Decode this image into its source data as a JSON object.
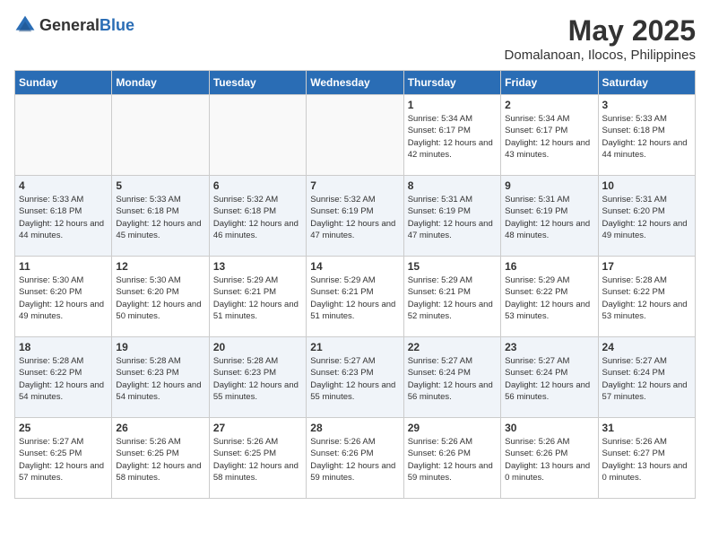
{
  "logo": {
    "general": "General",
    "blue": "Blue"
  },
  "title": {
    "month_year": "May 2025",
    "location": "Domalanoan, Ilocos, Philippines"
  },
  "weekdays": [
    "Sunday",
    "Monday",
    "Tuesday",
    "Wednesday",
    "Thursday",
    "Friday",
    "Saturday"
  ],
  "weeks": [
    [
      {
        "day": "",
        "info": ""
      },
      {
        "day": "",
        "info": ""
      },
      {
        "day": "",
        "info": ""
      },
      {
        "day": "",
        "info": ""
      },
      {
        "day": "1",
        "info": "Sunrise: 5:34 AM\nSunset: 6:17 PM\nDaylight: 12 hours\nand 42 minutes."
      },
      {
        "day": "2",
        "info": "Sunrise: 5:34 AM\nSunset: 6:17 PM\nDaylight: 12 hours\nand 43 minutes."
      },
      {
        "day": "3",
        "info": "Sunrise: 5:33 AM\nSunset: 6:18 PM\nDaylight: 12 hours\nand 44 minutes."
      }
    ],
    [
      {
        "day": "4",
        "info": "Sunrise: 5:33 AM\nSunset: 6:18 PM\nDaylight: 12 hours\nand 44 minutes."
      },
      {
        "day": "5",
        "info": "Sunrise: 5:33 AM\nSunset: 6:18 PM\nDaylight: 12 hours\nand 45 minutes."
      },
      {
        "day": "6",
        "info": "Sunrise: 5:32 AM\nSunset: 6:18 PM\nDaylight: 12 hours\nand 46 minutes."
      },
      {
        "day": "7",
        "info": "Sunrise: 5:32 AM\nSunset: 6:19 PM\nDaylight: 12 hours\nand 47 minutes."
      },
      {
        "day": "8",
        "info": "Sunrise: 5:31 AM\nSunset: 6:19 PM\nDaylight: 12 hours\nand 47 minutes."
      },
      {
        "day": "9",
        "info": "Sunrise: 5:31 AM\nSunset: 6:19 PM\nDaylight: 12 hours\nand 48 minutes."
      },
      {
        "day": "10",
        "info": "Sunrise: 5:31 AM\nSunset: 6:20 PM\nDaylight: 12 hours\nand 49 minutes."
      }
    ],
    [
      {
        "day": "11",
        "info": "Sunrise: 5:30 AM\nSunset: 6:20 PM\nDaylight: 12 hours\nand 49 minutes."
      },
      {
        "day": "12",
        "info": "Sunrise: 5:30 AM\nSunset: 6:20 PM\nDaylight: 12 hours\nand 50 minutes."
      },
      {
        "day": "13",
        "info": "Sunrise: 5:29 AM\nSunset: 6:21 PM\nDaylight: 12 hours\nand 51 minutes."
      },
      {
        "day": "14",
        "info": "Sunrise: 5:29 AM\nSunset: 6:21 PM\nDaylight: 12 hours\nand 51 minutes."
      },
      {
        "day": "15",
        "info": "Sunrise: 5:29 AM\nSunset: 6:21 PM\nDaylight: 12 hours\nand 52 minutes."
      },
      {
        "day": "16",
        "info": "Sunrise: 5:29 AM\nSunset: 6:22 PM\nDaylight: 12 hours\nand 53 minutes."
      },
      {
        "day": "17",
        "info": "Sunrise: 5:28 AM\nSunset: 6:22 PM\nDaylight: 12 hours\nand 53 minutes."
      }
    ],
    [
      {
        "day": "18",
        "info": "Sunrise: 5:28 AM\nSunset: 6:22 PM\nDaylight: 12 hours\nand 54 minutes."
      },
      {
        "day": "19",
        "info": "Sunrise: 5:28 AM\nSunset: 6:23 PM\nDaylight: 12 hours\nand 54 minutes."
      },
      {
        "day": "20",
        "info": "Sunrise: 5:28 AM\nSunset: 6:23 PM\nDaylight: 12 hours\nand 55 minutes."
      },
      {
        "day": "21",
        "info": "Sunrise: 5:27 AM\nSunset: 6:23 PM\nDaylight: 12 hours\nand 55 minutes."
      },
      {
        "day": "22",
        "info": "Sunrise: 5:27 AM\nSunset: 6:24 PM\nDaylight: 12 hours\nand 56 minutes."
      },
      {
        "day": "23",
        "info": "Sunrise: 5:27 AM\nSunset: 6:24 PM\nDaylight: 12 hours\nand 56 minutes."
      },
      {
        "day": "24",
        "info": "Sunrise: 5:27 AM\nSunset: 6:24 PM\nDaylight: 12 hours\nand 57 minutes."
      }
    ],
    [
      {
        "day": "25",
        "info": "Sunrise: 5:27 AM\nSunset: 6:25 PM\nDaylight: 12 hours\nand 57 minutes."
      },
      {
        "day": "26",
        "info": "Sunrise: 5:26 AM\nSunset: 6:25 PM\nDaylight: 12 hours\nand 58 minutes."
      },
      {
        "day": "27",
        "info": "Sunrise: 5:26 AM\nSunset: 6:25 PM\nDaylight: 12 hours\nand 58 minutes."
      },
      {
        "day": "28",
        "info": "Sunrise: 5:26 AM\nSunset: 6:26 PM\nDaylight: 12 hours\nand 59 minutes."
      },
      {
        "day": "29",
        "info": "Sunrise: 5:26 AM\nSunset: 6:26 PM\nDaylight: 12 hours\nand 59 minutes."
      },
      {
        "day": "30",
        "info": "Sunrise: 5:26 AM\nSunset: 6:26 PM\nDaylight: 13 hours\nand 0 minutes."
      },
      {
        "day": "31",
        "info": "Sunrise: 5:26 AM\nSunset: 6:27 PM\nDaylight: 13 hours\nand 0 minutes."
      }
    ]
  ]
}
